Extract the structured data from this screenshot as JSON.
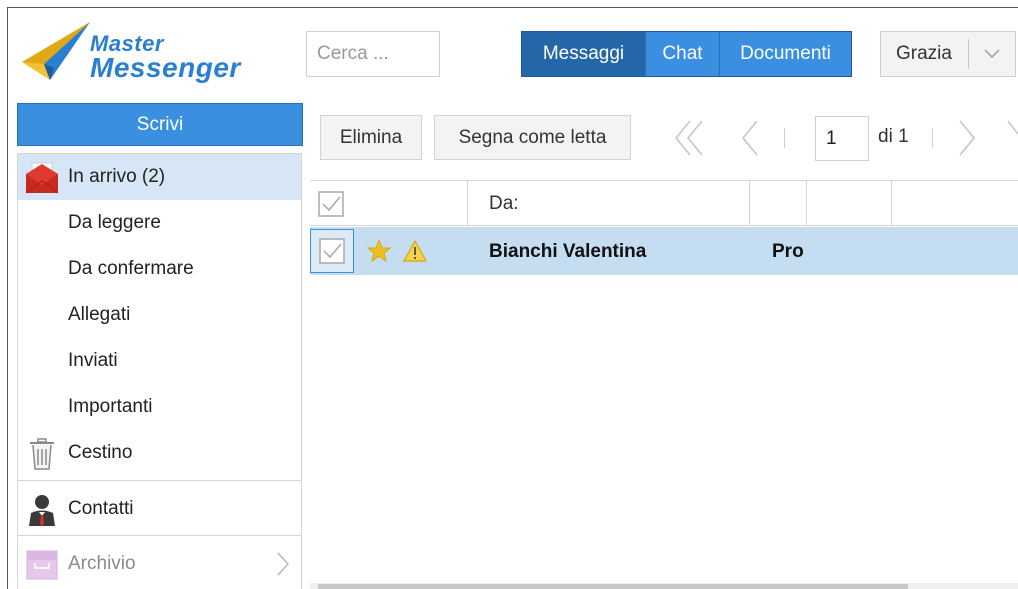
{
  "logo": {
    "line1": "Master",
    "line2": "Messenger"
  },
  "search": {
    "placeholder": "Cerca ...",
    "value": ""
  },
  "tabs": [
    {
      "label": "Messaggi",
      "active": true
    },
    {
      "label": "Chat",
      "active": false
    },
    {
      "label": "Documenti",
      "active": false
    }
  ],
  "user": {
    "name": "Grazia"
  },
  "sidebar": {
    "compose_label": "Scrivi",
    "items": [
      {
        "label": "In arrivo (2)",
        "icon": "envelope-icon",
        "active": true
      },
      {
        "label": "Da leggere",
        "icon": ""
      },
      {
        "label": "Da confermare",
        "icon": ""
      },
      {
        "label": "Allegati",
        "icon": ""
      },
      {
        "label": "Inviati",
        "icon": ""
      },
      {
        "label": "Importanti",
        "icon": ""
      },
      {
        "label": "Cestino",
        "icon": "trash-icon"
      },
      {
        "label": "Contatti",
        "icon": "contact-icon"
      },
      {
        "label": "Archivio",
        "icon": "archive-icon"
      }
    ]
  },
  "toolbar": {
    "delete_label": "Elimina",
    "mark_read_label": "Segna come letta",
    "page": "1",
    "page_total": "di 1"
  },
  "table": {
    "header_from": "Da:",
    "rows": [
      {
        "sender": "Bianchi Valentina",
        "subject": "Pro",
        "starred": true,
        "warning": true,
        "selected": true
      }
    ]
  },
  "colors": {
    "accent": "#3a8fe0",
    "tab_active": "#2467a8",
    "row_selected": "#c5ddf1",
    "nav_active": "#d6e6f6",
    "logo": "#2b7fd3",
    "star": "#f0c020"
  }
}
